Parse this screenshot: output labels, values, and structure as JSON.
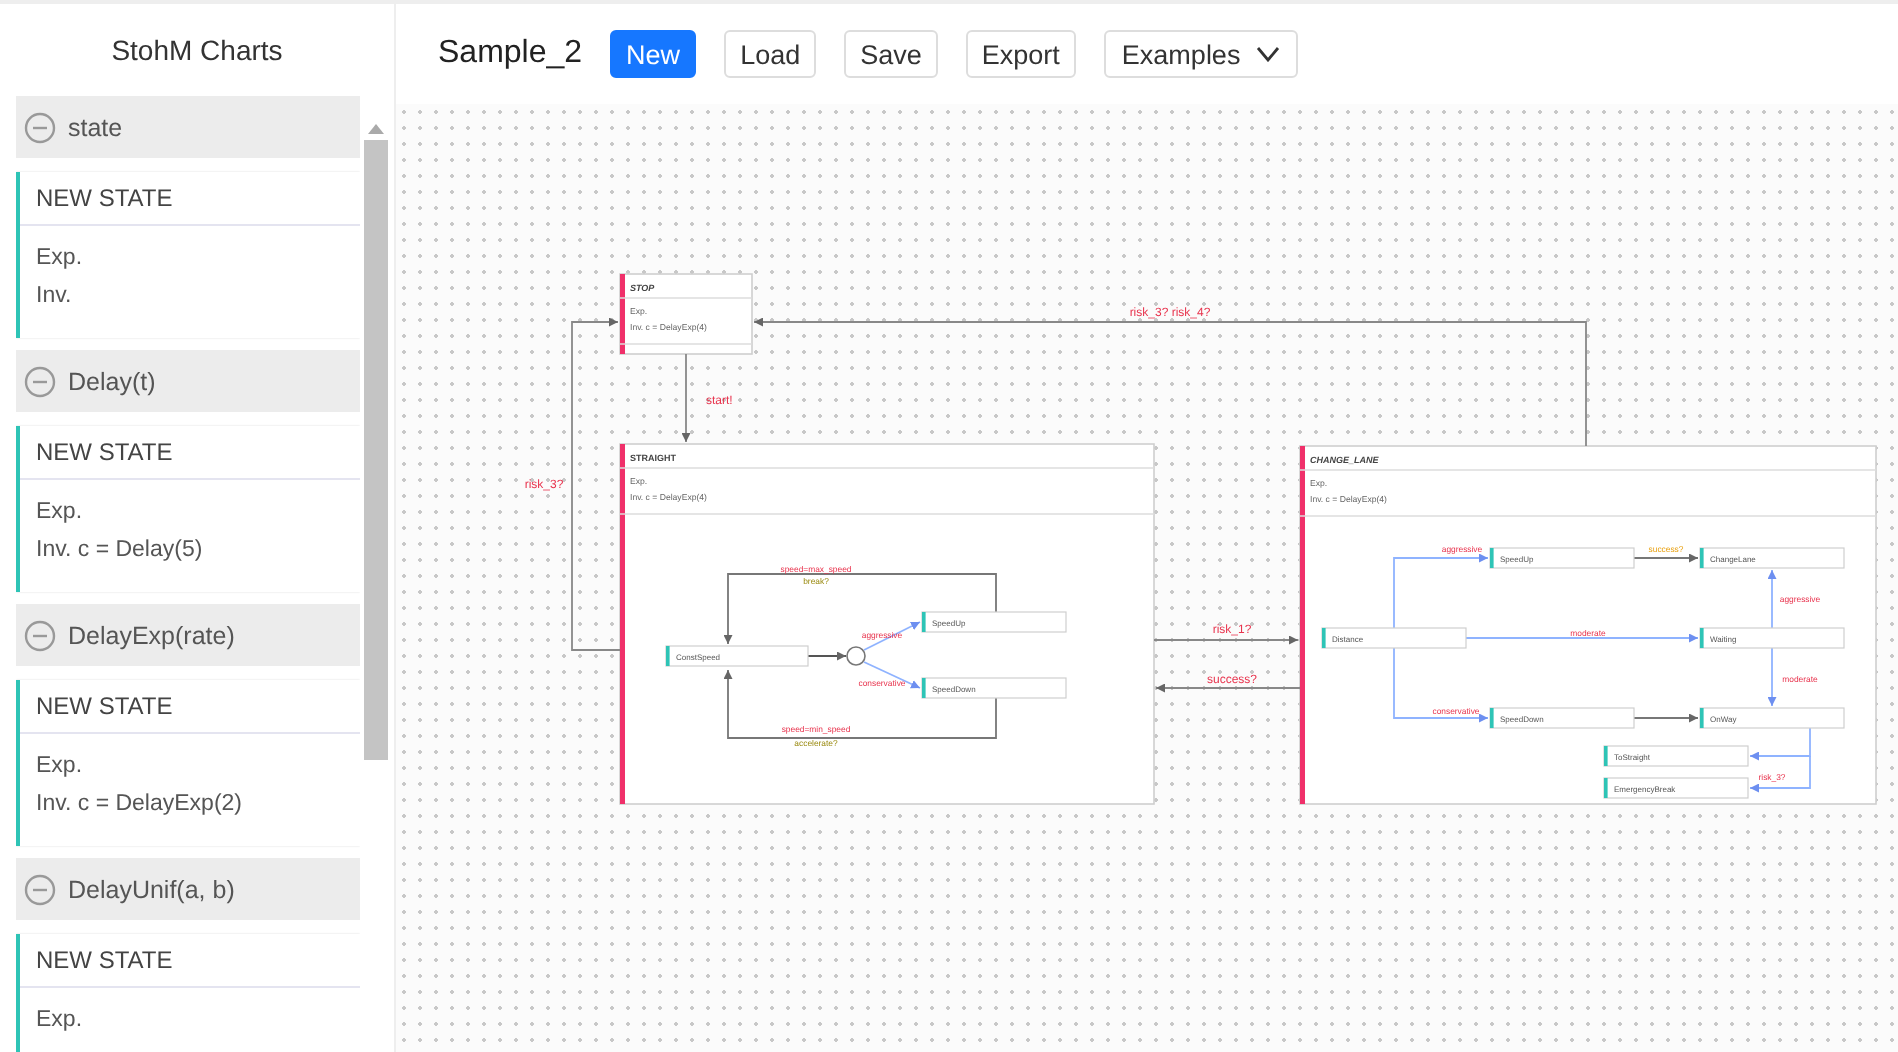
{
  "app": {
    "title": "StohM Charts"
  },
  "toolbar": {
    "chart_name": "Sample_2",
    "buttons": [
      {
        "label": "New",
        "selected": true
      },
      {
        "label": "Load",
        "selected": false
      },
      {
        "label": "Save",
        "selected": false
      },
      {
        "label": "Export",
        "selected": false
      }
    ],
    "dropdown": {
      "label": "Examples"
    }
  },
  "palette": [
    {
      "title": "state",
      "expanded": true,
      "card": {
        "name": "NEW STATE",
        "lines": [
          "Exp.",
          "Inv."
        ]
      }
    },
    {
      "title": "Delay(t)",
      "expanded": true,
      "card": {
        "name": "NEW STATE",
        "lines": [
          "Exp.",
          "Inv. c = Delay(5)"
        ]
      }
    },
    {
      "title": "DelayExp(rate)",
      "expanded": true,
      "card": {
        "name": "NEW STATE",
        "lines": [
          "Exp.",
          "Inv. c = DelayExp(2)"
        ]
      }
    },
    {
      "title": "DelayUnif(a, b)",
      "expanded": true,
      "card": {
        "name": "NEW STATE",
        "lines": [
          "Exp."
        ]
      }
    }
  ],
  "diagram": {
    "states": [
      {
        "name": "STOP",
        "exp": "Exp.",
        "inv": "Inv. c = DelayExp(4)"
      },
      {
        "name": "STRAIGHT",
        "exp": "Exp.",
        "inv": "Inv. c = DelayExp(4)",
        "substates": [
          "ConstSpeed",
          "SpeedUp",
          "SpeedDown"
        ],
        "labels": [
          {
            "text": "speed=max_speed",
            "kind": "guard"
          },
          {
            "text": "break?",
            "kind": "action"
          },
          {
            "text": "aggressive",
            "kind": "guard"
          },
          {
            "text": "conservative",
            "kind": "guard"
          },
          {
            "text": "speed=min_speed",
            "kind": "guard"
          },
          {
            "text": "accelerate?",
            "kind": "action"
          }
        ]
      },
      {
        "name": "CHANGE_LANE",
        "exp": "Exp.",
        "inv": "Inv. c = DelayExp(4)",
        "substates": [
          "Distance",
          "SpeedUp",
          "ChangeLane",
          "Waiting",
          "SpeedDown",
          "OnWay",
          "ToStraight",
          "EmergencyBreak"
        ],
        "labels": [
          {
            "text": "aggressive",
            "kind": "guard"
          },
          {
            "text": "success?",
            "kind": "event"
          },
          {
            "text": "aggressive",
            "kind": "guard"
          },
          {
            "text": "moderate",
            "kind": "guard"
          },
          {
            "text": "conservative",
            "kind": "guard"
          },
          {
            "text": "moderate",
            "kind": "guard"
          },
          {
            "text": "risk_3?",
            "kind": "guard"
          }
        ]
      }
    ],
    "transitions": [
      {
        "label": "start!"
      },
      {
        "label": "risk_3? risk_4?"
      },
      {
        "label": "risk_3?"
      },
      {
        "label": "risk_1?"
      },
      {
        "label": "success?"
      }
    ]
  }
}
